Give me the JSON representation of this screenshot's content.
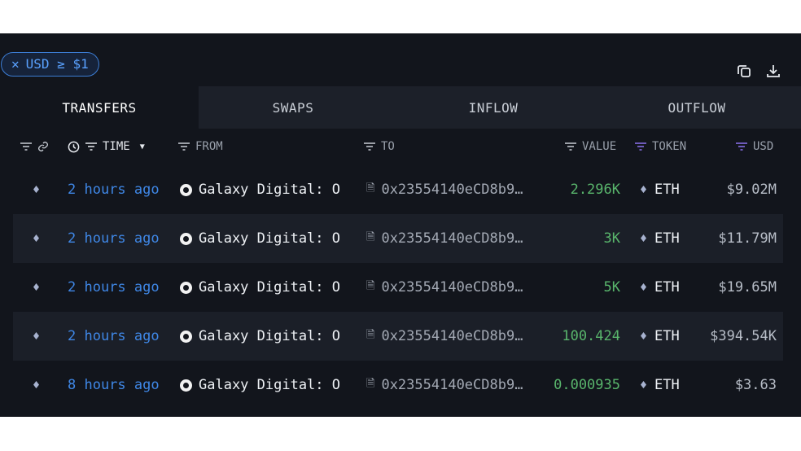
{
  "filter": {
    "label": "USD ≥ $1"
  },
  "tabs": [
    {
      "label": "TRANSFERS",
      "active": true
    },
    {
      "label": "SWAPS",
      "active": false
    },
    {
      "label": "INFLOW",
      "active": false
    },
    {
      "label": "OUTFLOW",
      "active": false
    }
  ],
  "columns": {
    "time": "TIME",
    "from": "FROM",
    "to": "TO",
    "value": "VALUE",
    "token": "TOKEN",
    "usd": "USD"
  },
  "rows": [
    {
      "time": "2 hours ago",
      "from": "Galaxy Digital: O",
      "to": "0x23554140eCD8b9…",
      "value": "2.296K",
      "token": "ETH",
      "usd": "$9.02M"
    },
    {
      "time": "2 hours ago",
      "from": "Galaxy Digital: O",
      "to": "0x23554140eCD8b9…",
      "value": "3K",
      "token": "ETH",
      "usd": "$11.79M"
    },
    {
      "time": "2 hours ago",
      "from": "Galaxy Digital: O",
      "to": "0x23554140eCD8b9…",
      "value": "5K",
      "token": "ETH",
      "usd": "$19.65M"
    },
    {
      "time": "2 hours ago",
      "from": "Galaxy Digital: O",
      "to": "0x23554140eCD8b9…",
      "value": "100.424",
      "token": "ETH",
      "usd": "$394.54K"
    },
    {
      "time": "8 hours ago",
      "from": "Galaxy Digital: O",
      "to": "0x23554140eCD8b9…",
      "value": "0.000935",
      "token": "ETH",
      "usd": "$3.63"
    }
  ],
  "colors": {
    "accent": "#3f87e6",
    "value": "#59b56c",
    "background": "#12151c"
  },
  "icons": [
    "close-icon",
    "copy-icon",
    "download-icon",
    "filter-icon",
    "link-icon",
    "clock-icon",
    "caret-down-icon",
    "eth-icon",
    "entity-icon",
    "document-icon"
  ]
}
